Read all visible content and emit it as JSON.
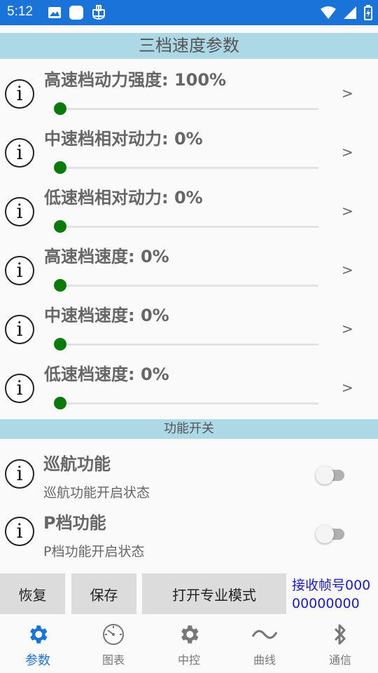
{
  "status_bar": {
    "time": "5:12"
  },
  "sections": {
    "speed_header": "三档速度参数",
    "function_header": "功能开关"
  },
  "sliders": [
    {
      "label": "高速档动力强度: 100%",
      "value_percent": 100,
      "arrow": ">"
    },
    {
      "label": "中速档相对动力: 0%",
      "value_percent": 0,
      "arrow": ">"
    },
    {
      "label": "低速档相对动力: 0%",
      "value_percent": 0,
      "arrow": ">"
    },
    {
      "label": "高速档速度: 0%",
      "value_percent": 0,
      "arrow": ">"
    },
    {
      "label": "中速档速度: 0%",
      "value_percent": 0,
      "arrow": ">"
    },
    {
      "label": "低速档速度: 0%",
      "value_percent": 0,
      "arrow": ">"
    }
  ],
  "info_icon_glyph": "i",
  "switches": [
    {
      "title": "巡航功能",
      "subtitle": "巡航功能开启状态",
      "on": false
    },
    {
      "title": "P档功能",
      "subtitle": "P档功能开启状态",
      "on": false
    }
  ],
  "partial_row": "",
  "actions": {
    "restore": "恢复",
    "save": "保存",
    "pro_mode": "打开专业模式",
    "receive_frame": "接收帧号00000000000"
  },
  "bottom_nav": [
    {
      "label": "参数",
      "icon": "gear-icon",
      "active": true
    },
    {
      "label": "图表",
      "icon": "gauge-icon",
      "active": false
    },
    {
      "label": "中控",
      "icon": "gear-icon",
      "active": false
    },
    {
      "label": "曲线",
      "icon": "wave-icon",
      "active": false
    },
    {
      "label": "通信",
      "icon": "bluetooth-icon",
      "active": false
    }
  ],
  "colors": {
    "status_bar": "#1a73d9",
    "section_header": "#add8e6",
    "slider_thumb": "#0a7a0a",
    "nav_active": "#1a73d9",
    "receive_text": "#1a1acc"
  }
}
